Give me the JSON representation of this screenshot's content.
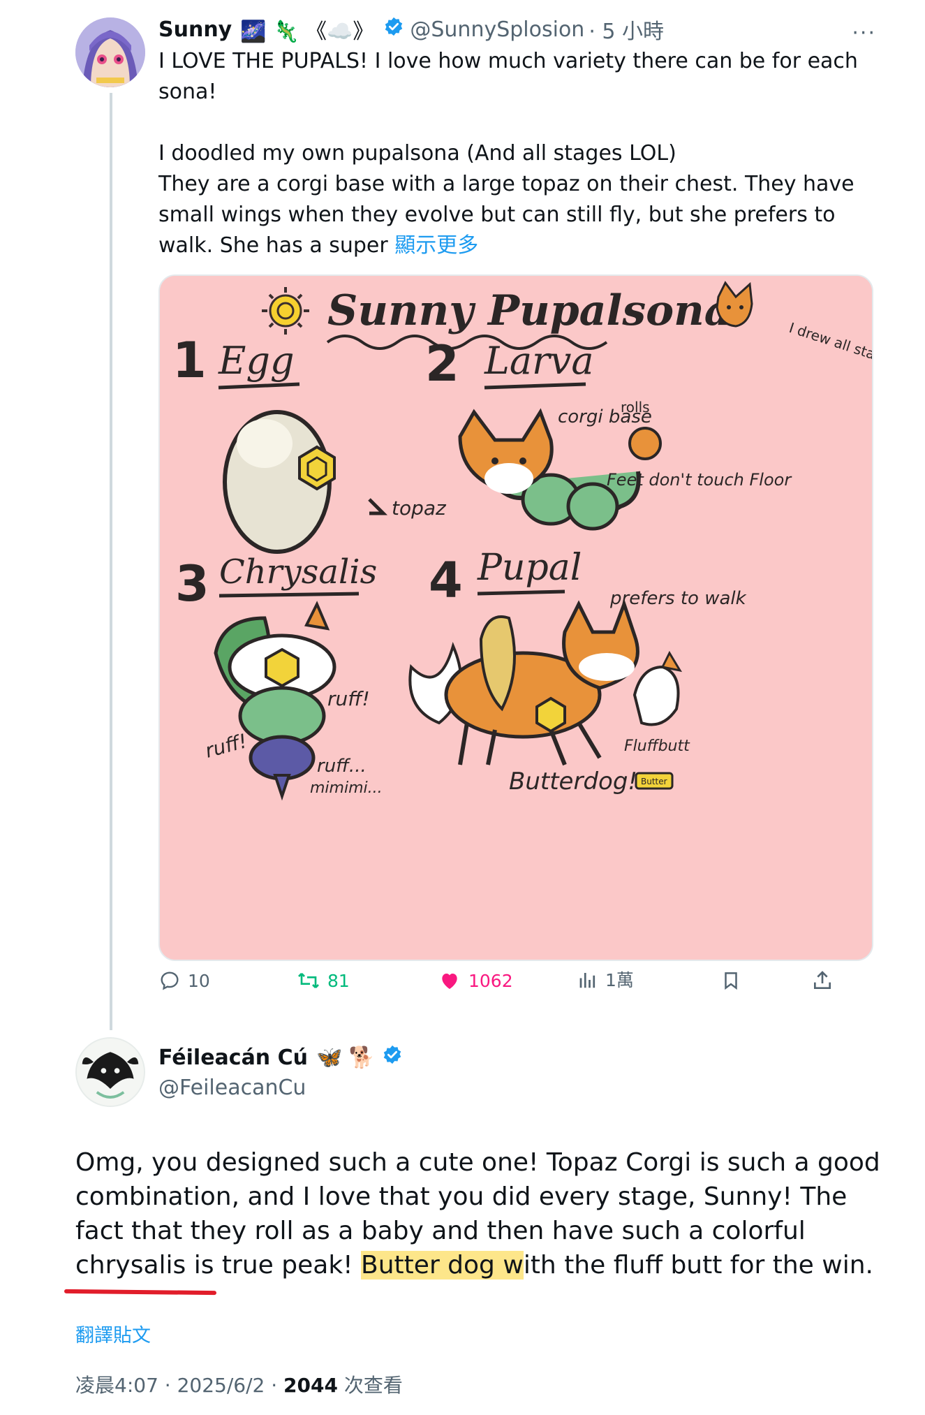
{
  "post": {
    "author_name": "Sunny",
    "author_emoji": "🌌 🦎 《☁️》",
    "handle": "@SunnySplosion",
    "time": "· 5 小時",
    "more": "···",
    "text": "I LOVE THE PUPALS! I love how much variety there can be for each sona!\n\nI doodled my own pupalsona (And all stages LOL)\nThey are a corgi base with a large topaz on their chest. They have small wings when they evolve but can still fly, but she prefers to walk. She has a super ",
    "show_more": "顯示更多",
    "image": {
      "title": "Sunny Pupalsona!",
      "note": "I drew all stages I was havin fun",
      "stage1_num": "1",
      "stage1": "Egg",
      "stage2_num": "2",
      "stage2": "Larva",
      "stage3_num": "3",
      "stage3": "Chrysalis",
      "stage4_num": "4",
      "stage4": "Pupal",
      "topaz": "topaz",
      "corgi_base": "corgi base",
      "rolls": "rolls",
      "feet": "Feet don't touch Floor",
      "ruff1": "ruff!",
      "ruff2": "ruff!",
      "ruff3": "ruff...",
      "mimimi": "mimimi...",
      "prefers": "prefers to walk",
      "fluffbutt": "Fluffbutt",
      "butterdog": "Butterdog!",
      "butter": "Butter"
    },
    "stats": {
      "replies": "10",
      "reposts": "81",
      "likes": "1062",
      "views": "1萬"
    }
  },
  "reply": {
    "author_name": "Féileacán Cú",
    "author_emoji": "🦋 🐕",
    "handle": "@FeileacanCu",
    "text_highlight": "Butter dog w",
    "text_before": "Omg, you designed such a cute one! Topaz Corgi is such a good combination, and I love that you did every stage, Sunny! The fact that they roll as a baby and then have such a colorful chrysalis is true peak! ",
    "text_after": "ith the fluff butt for the win.",
    "translate": "翻譯貼文",
    "time": "凌晨4:07 · 2025/6/2 · ",
    "views_count": "2044",
    "views_label": " 次查看"
  },
  "colors": {
    "link": "#1d9bf0",
    "like": "#f91880",
    "repost": "#00ba7c",
    "highlight": "#fde68a",
    "underline": "#e11d2a",
    "verified": "#1d9bf0"
  }
}
